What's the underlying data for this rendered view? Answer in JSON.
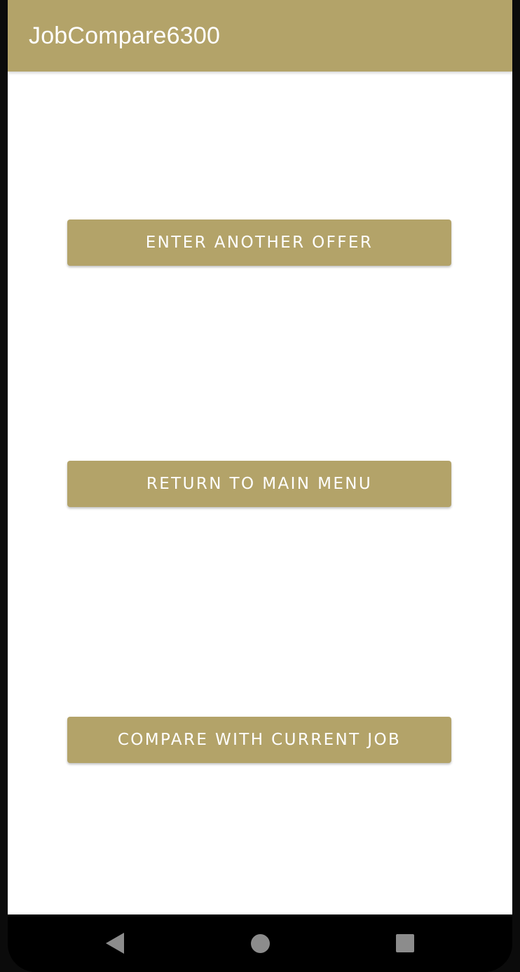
{
  "app_bar": {
    "title": "JobCompare6300",
    "color": "#b3a369"
  },
  "buttons": [
    {
      "label": "ENTER ANOTHER OFFER"
    },
    {
      "label": "RETURN TO MAIN MENU"
    },
    {
      "label": "COMPARE WITH CURRENT JOB"
    }
  ],
  "navigation": {
    "back_icon": "triangle-back-icon",
    "home_icon": "circle-home-icon",
    "recents_icon": "square-recents-icon"
  }
}
